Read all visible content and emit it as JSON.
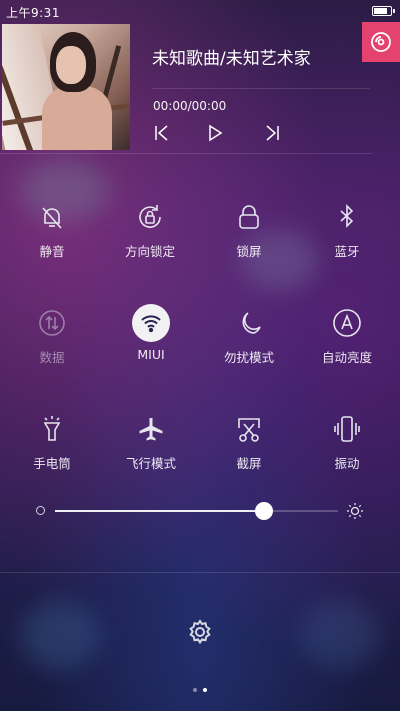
{
  "status_bar": {
    "time": "上午9:31",
    "battery_level": 0.85
  },
  "music": {
    "title": "未知歌曲/未知艺术家",
    "progress": "00:00/00:00"
  },
  "toggles": [
    {
      "label": "静音",
      "icon": "mute-bell-icon",
      "active": false
    },
    {
      "label": "方向锁定",
      "icon": "rotation-lock-icon",
      "active": false
    },
    {
      "label": "锁屏",
      "icon": "lock-icon",
      "active": false
    },
    {
      "label": "蓝牙",
      "icon": "bluetooth-icon",
      "active": false
    },
    {
      "label": "数据",
      "icon": "mobile-data-icon",
      "active": false,
      "disabled": true
    },
    {
      "label": "MIUI",
      "icon": "wifi-icon",
      "active": true
    },
    {
      "label": "勿扰模式",
      "icon": "moon-icon",
      "active": false
    },
    {
      "label": "自动亮度",
      "icon": "auto-brightness-icon",
      "active": false
    },
    {
      "label": "手电筒",
      "icon": "flashlight-icon",
      "active": false
    },
    {
      "label": "飞行模式",
      "icon": "airplane-icon",
      "active": false
    },
    {
      "label": "截屏",
      "icon": "screenshot-icon",
      "active": false
    },
    {
      "label": "振动",
      "icon": "vibrate-icon",
      "active": false
    }
  ],
  "brightness": {
    "level": 0.74
  },
  "pager": {
    "page_count": 2,
    "current_page": 2
  },
  "colors": {
    "accent": "#e5436f",
    "wifi_active_bg": "#f2f2f4"
  }
}
